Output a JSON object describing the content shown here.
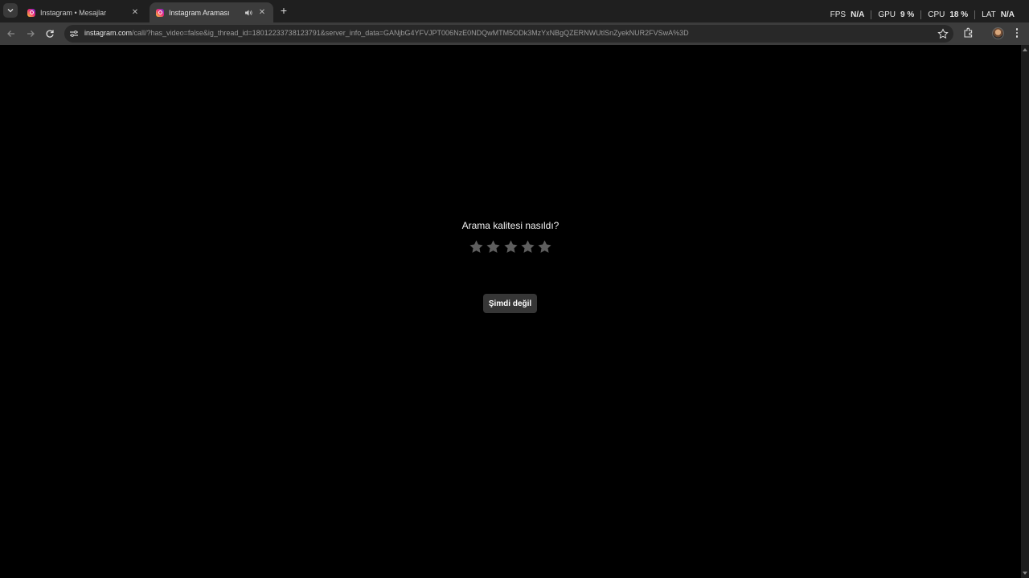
{
  "browser": {
    "tabs": [
      {
        "title": "Instagram • Mesajlar",
        "active": false
      },
      {
        "title": "Instagram Araması",
        "active": true
      }
    ],
    "url_host": "instagram.com",
    "url_path": "/call/?has_video=false&ig_thread_id=18012233738123791&server_info_data=GANjbG4YFVJPT006NzE0NDQwMTM5ODk3MzYxNBgQZERNWUtlSnZyekNUR2FVSwA%3D"
  },
  "overlay": {
    "stats": [
      {
        "label": "FPS",
        "value": "N/A"
      },
      {
        "label": "GPU",
        "value": "9 %"
      },
      {
        "label": "CPU",
        "value": "18 %"
      },
      {
        "label": "LAT",
        "value": "N/A"
      }
    ]
  },
  "page": {
    "rating_prompt": "Arama kalitesi nasıldı?",
    "star_count": 5,
    "selected_rating": 0,
    "dismiss_label": "Şimdi değil"
  },
  "colors": {
    "background": "#000000",
    "star": "#5e5e5e",
    "button_bg": "#363636"
  }
}
